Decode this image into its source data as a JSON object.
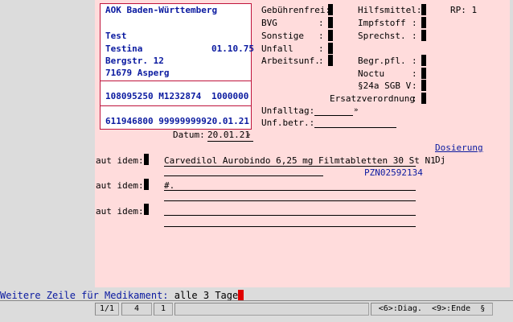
{
  "card": {
    "insurer": "AOK Baden-Württemberg",
    "last_name": "Test",
    "first_name": "Testina",
    "birth_date": "01.10.75",
    "street": "Bergstr. 12",
    "city": "71679 Asperg",
    "ids_line": "108095250 M1232874",
    "status_code": "1000000",
    "bsnr_lanr": "611946800 999999999",
    "card_date": "20.01.21"
  },
  "datum": {
    "label": "Datum:",
    "value": "20.01.21"
  },
  "flags": {
    "gebuehrenfrei": "Gebührenfrei:",
    "bvg": "BVG",
    "sonstige": "Sonstige",
    "unfall": "Unfall",
    "arbeitsunf": "Arbeitsunf.",
    "hilfsmittel": "Hilfsmittel:",
    "impfstoff": "Impfstoff",
    "sprechst": "Sprechst.",
    "rp_label": "RP: 1",
    "begr_pfl": "Begr.pfl.",
    "noctu": "Noctu",
    "sgb": "§24a SGB V",
    "ersatz": "Ersatzverordnung",
    "colon": ":"
  },
  "unfall": {
    "tag_label": "Unfalltag:",
    "betr_label": "Unf.betr.:"
  },
  "dosierung": {
    "header": "Dosierung",
    "value": "Dj"
  },
  "rx": {
    "aut_idem_label": "aut idem:",
    "line1": "Carvedilol Aurobindo 6,25 mg Filmtabletten 30 St N1",
    "pzn": "PZN02592134",
    "line2": "#."
  },
  "prompt": {
    "label": "Weitere Zeile für Medikament:",
    "value": "alle 3 Tage"
  },
  "statusbar": {
    "page": "1/1",
    "c2": "4",
    "c3": "1",
    "keys": "<6>:Diag.  <9>:Ende  §"
  }
}
